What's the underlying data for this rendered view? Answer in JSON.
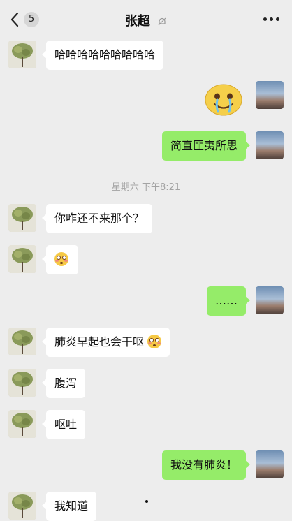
{
  "header": {
    "unread_count": "5",
    "contact_name": "张超"
  },
  "messages": [
    {
      "text": "哈哈哈哈哈哈哈哈哈"
    },
    {
      "text": "简直匪夷所思"
    },
    {
      "text": "你咋还不来那个？"
    },
    {
      "text": "……"
    },
    {
      "text": "肺炎早起也会干呕"
    },
    {
      "text": "腹泻"
    },
    {
      "text": "呕吐"
    },
    {
      "text": "我没有肺炎！"
    },
    {
      "text": "我知道"
    }
  ],
  "timestamp": "星期六 下午8:21",
  "colors": {
    "background": "#ededed",
    "incoming_bubble": "#ffffff",
    "outgoing_bubble": "#95ec69",
    "timestamp_text": "#a3a3a3"
  },
  "icons": [
    "back-chevron-icon",
    "mute-bell-icon",
    "more-dots-icon",
    "flushed-face-emoji-icon",
    "crying-smile-sticker-icon"
  ]
}
